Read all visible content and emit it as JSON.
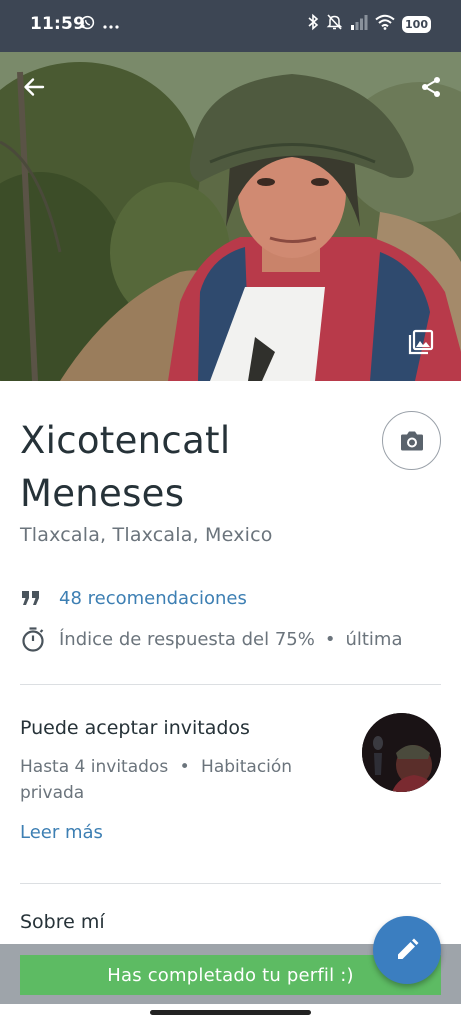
{
  "status_bar": {
    "time": "11:59",
    "battery": "100",
    "icons": [
      "whatsapp-icon",
      "more-dots-icon",
      "bluetooth-icon",
      "mute-icon",
      "signal-icon",
      "wifi-icon"
    ]
  },
  "hero": {
    "icons": [
      "back-arrow-icon",
      "share-icon",
      "photo-gallery-icon"
    ]
  },
  "profile": {
    "name": "Xicotencatl Meneses",
    "location": "Tlaxcala, Tlaxcala, Mexico",
    "recommendations": "48 recomendaciones",
    "response_rate": "Índice de respuesta del 75%",
    "response_separator": "•",
    "response_last": "última"
  },
  "guests": {
    "title": "Puede aceptar invitados",
    "count": "Hasta 4 invitados",
    "separator": "•",
    "room": "Habitación privada",
    "read_more": "Leer más"
  },
  "about": {
    "title": "Sobre mí"
  },
  "banner": {
    "text": "Has completado tu perfil :)"
  },
  "colors": {
    "link": "#3d7fb3",
    "banner": "#5dbb63",
    "fab": "#3b7ec0",
    "status_bar": "#3d4654"
  }
}
